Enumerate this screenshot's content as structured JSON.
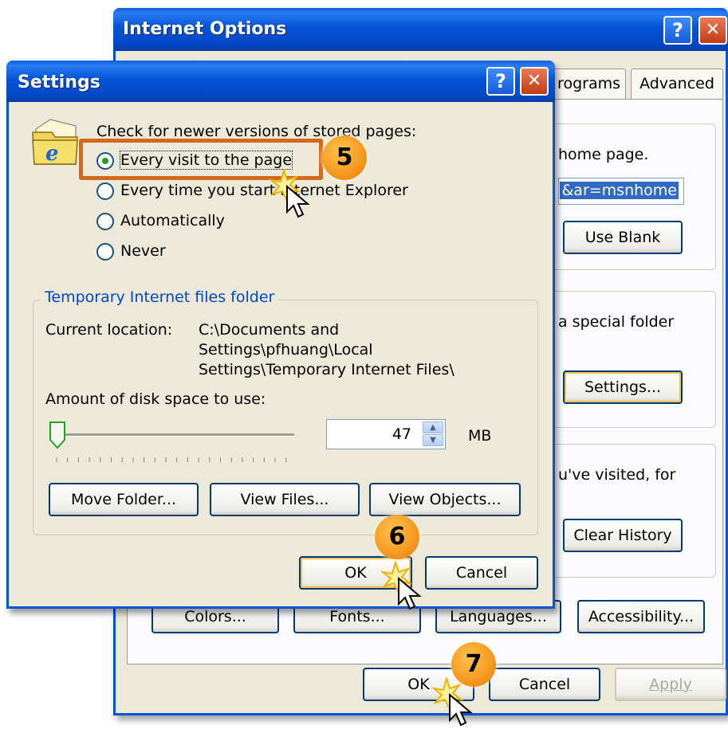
{
  "internet_options": {
    "title": "Internet Options",
    "help_glyph": "?",
    "close_glyph": "✕",
    "tabs": [
      "rograms",
      "Advanced"
    ],
    "home_text": "home page.",
    "home_field_value": "&ar=msnhome",
    "use_blank_label": "Use Blank",
    "temp_text": "a special folder",
    "settings_label": "Settings...",
    "history_text": "u've visited, for",
    "clear_history_label": "Clear History",
    "colors_label": "Colors...",
    "fonts_label": "Fonts...",
    "languages_label": "Languages...",
    "accessibility_label": "Accessibility...",
    "ok_label": "OK",
    "cancel_label": "Cancel",
    "apply_label": "Apply"
  },
  "settings_dialog": {
    "title": "Settings",
    "help_glyph": "?",
    "close_glyph": "✕",
    "check_label": "Check for newer versions of stored pages:",
    "options": [
      {
        "label": "Every visit to the page",
        "selected": true
      },
      {
        "label": "Every time you start Internet Explorer",
        "selected": false
      },
      {
        "label": "Automatically",
        "selected": false
      },
      {
        "label": "Never",
        "selected": false
      }
    ],
    "group_title": "Temporary Internet files folder",
    "current_location_label": "Current location:",
    "location_lines": [
      "C:\\Documents and",
      "Settings\\pfhuang\\Local",
      "Settings\\Temporary Internet Files\\"
    ],
    "disk_space_label": "Amount of disk space to use:",
    "disk_space_value": "47",
    "disk_space_unit": "MB",
    "slider_level": 0,
    "move_folder_label": "Move Folder...",
    "view_files_label": "View Files...",
    "view_objects_label": "View Objects...",
    "ok_label": "OK",
    "cancel_label": "Cancel"
  },
  "step_badges": [
    "5",
    "6",
    "7"
  ],
  "colors": {
    "title_blue": "#0553d6",
    "highlight_orange": "#d2691e",
    "badge_orange": "#f39118",
    "group_title_blue": "#0046d5"
  }
}
